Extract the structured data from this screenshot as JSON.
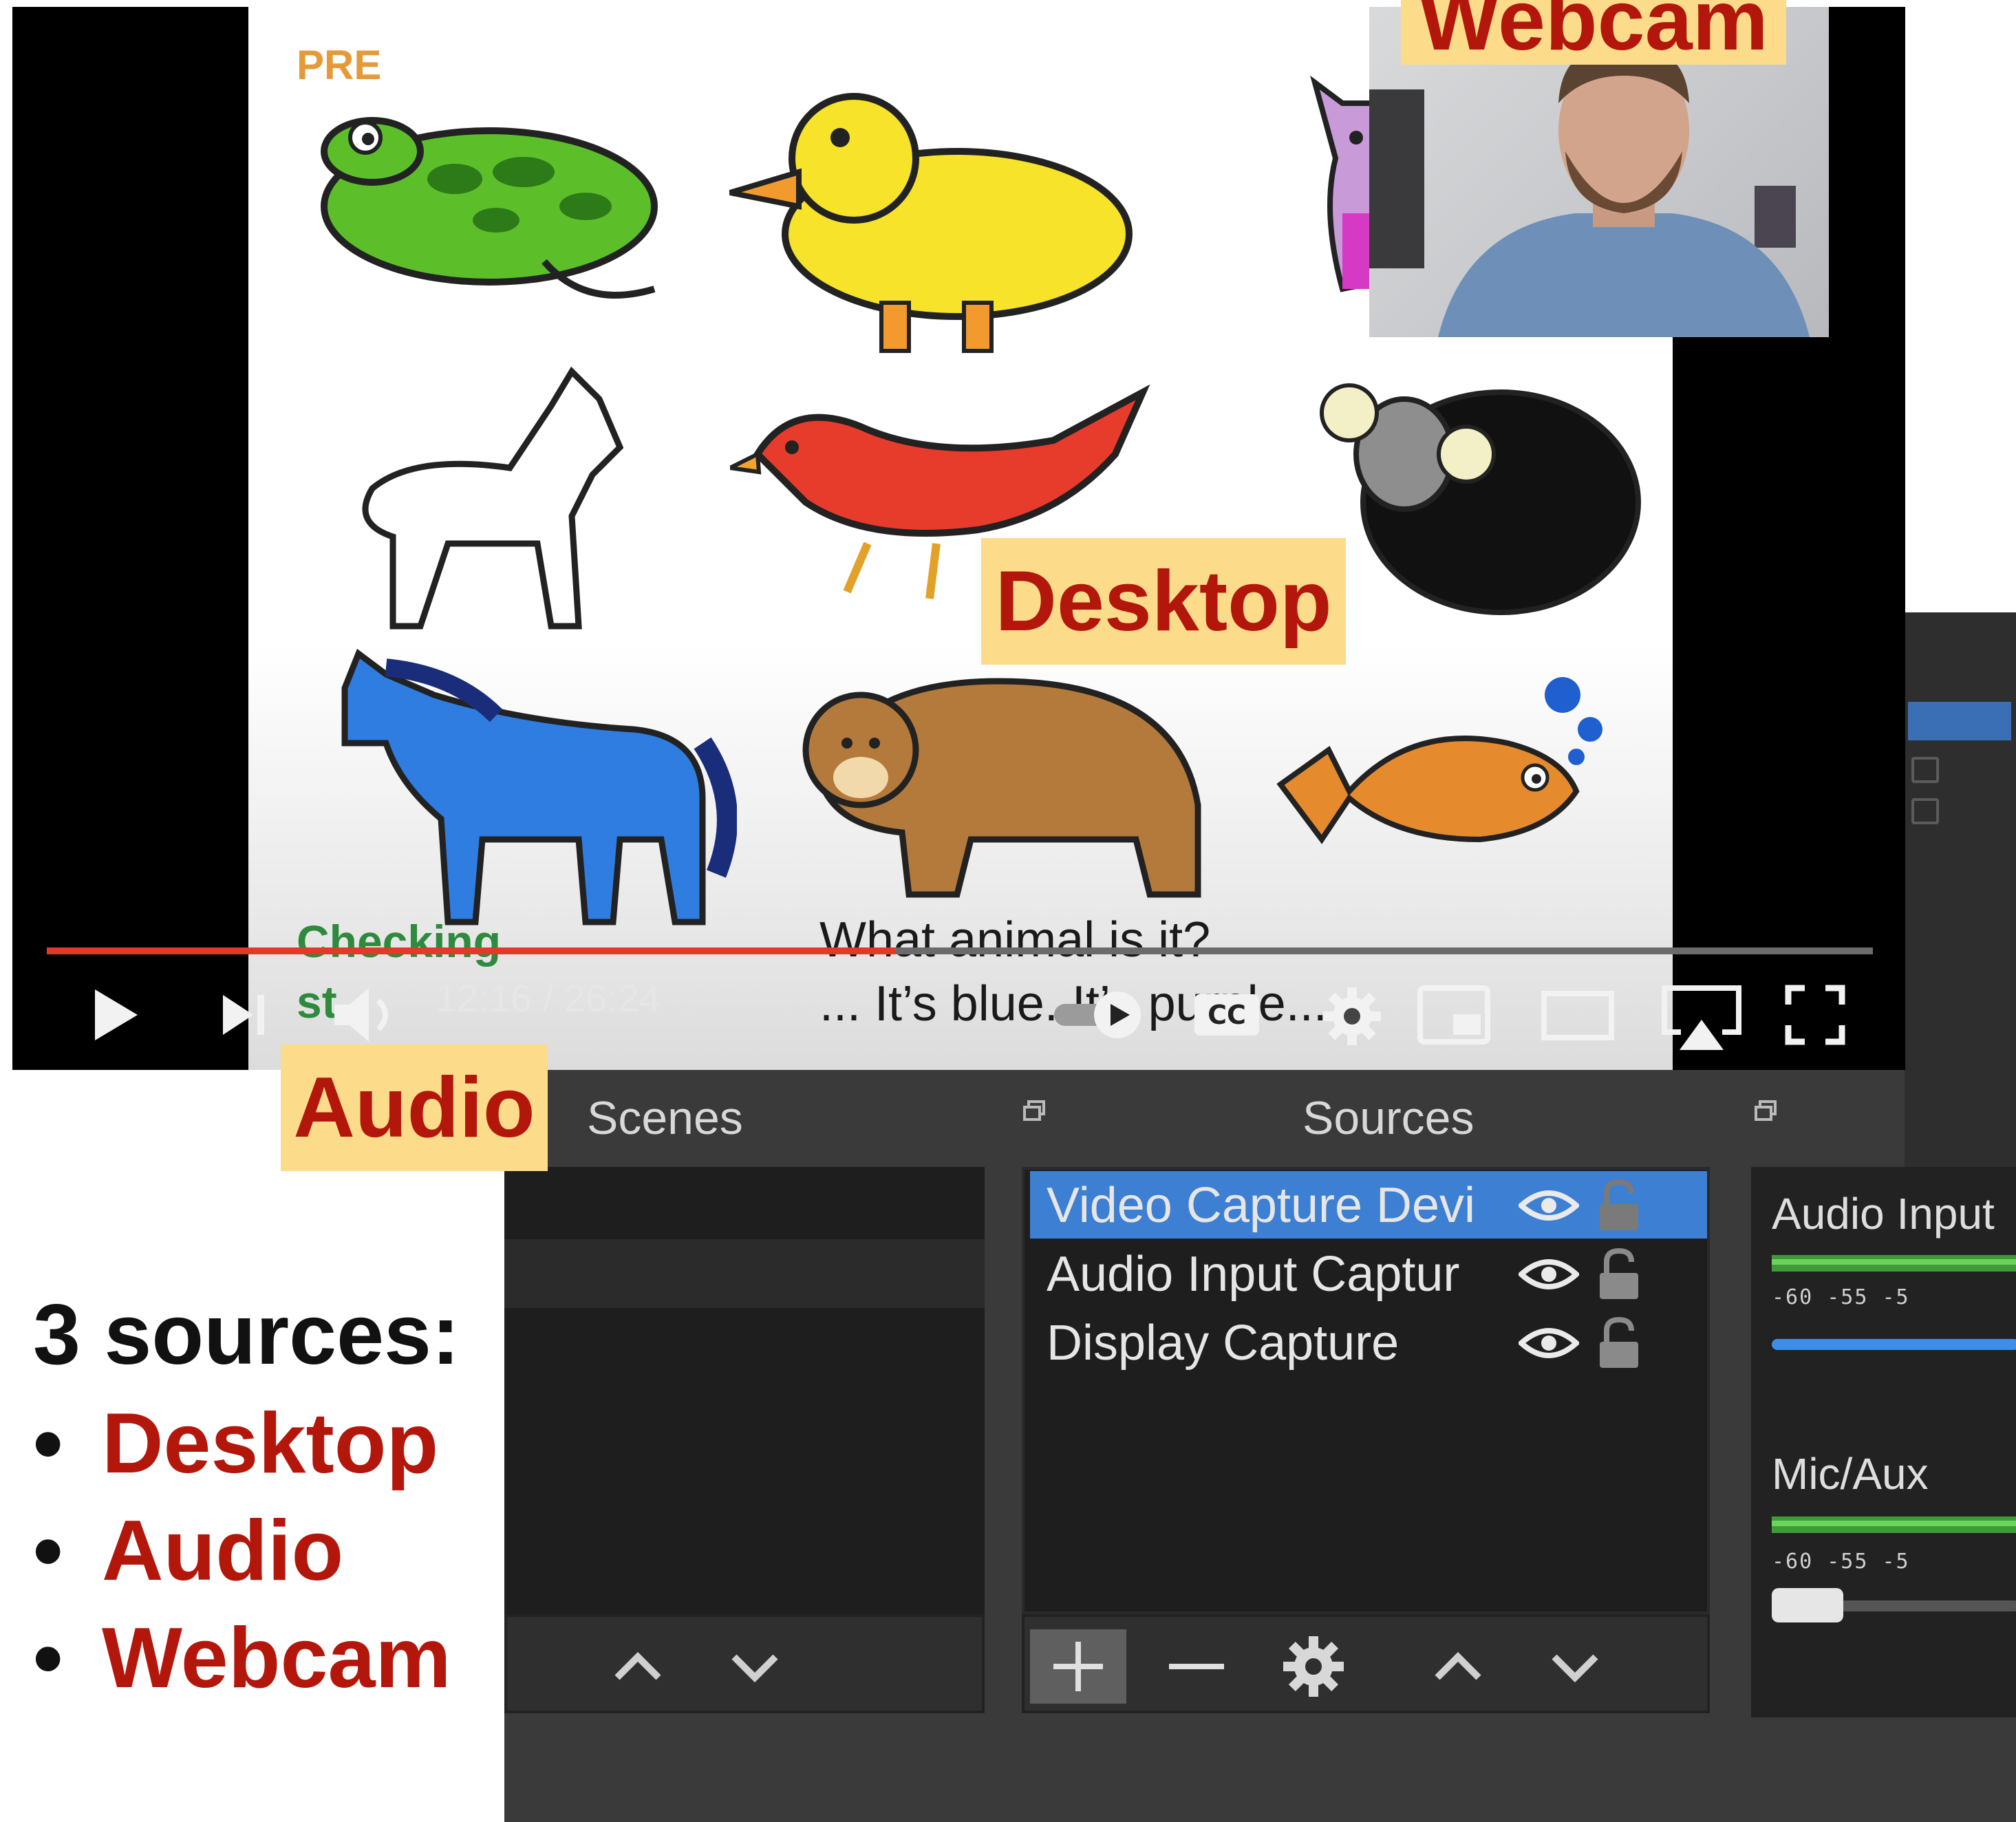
{
  "player": {
    "slide_tag": "PRE",
    "caption_line1": "What animal is it?",
    "caption_line2": "... It’s blue. It’s purple...",
    "corner_text_1": "Checking",
    "corner_text_2": "st",
    "time": "12:16 / 26:24",
    "progress_fraction": 0.465,
    "cc_label": "CC",
    "controls": [
      "play-icon",
      "next-icon",
      "volume-icon",
      "autoplay-toggle",
      "cc-icon",
      "settings-icon",
      "miniplayer-icon",
      "theater-icon",
      "airplay-icon",
      "fullscreen-icon"
    ]
  },
  "obs": {
    "scenes_title": "Scenes",
    "sources_title": "Sources",
    "sources": [
      {
        "label": "Video Capture Devi",
        "selected": true
      },
      {
        "label": "Audio Input Captur",
        "selected": false
      },
      {
        "label": "Display Capture",
        "selected": false
      }
    ],
    "mixer": [
      {
        "label": "Audio Input",
        "ticks": "-60  -55  -5",
        "volume_color": "#3d8ee8"
      },
      {
        "label": "Mic/Aux",
        "ticks": "-60  -55  -5",
        "volume_color": "#555555"
      }
    ]
  },
  "tags": {
    "webcam": "Webcam",
    "desktop": "Desktop",
    "audio": "Audio"
  },
  "summary": {
    "title": "3 sources:",
    "items": [
      "Desktop",
      "Audio",
      "Webcam"
    ],
    "bullet": "•"
  },
  "colors": {
    "tag_bg": "#fcdc8b",
    "tag_text": "#b3170b",
    "progress": "#e03a2b",
    "selection": "#3d7fd3"
  }
}
